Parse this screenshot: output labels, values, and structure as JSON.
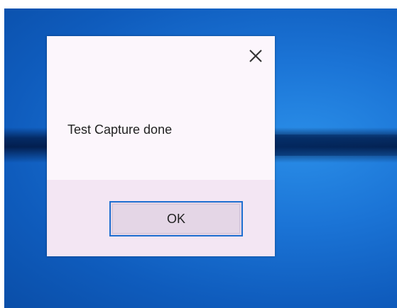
{
  "dialog": {
    "message": "Test Capture done",
    "ok_label": "OK"
  },
  "icons": {
    "close": "close-icon"
  },
  "colors": {
    "desktop_blue": "#1b74d6",
    "dialog_background": "#fcf6fc",
    "footer_background": "#f3e6f3",
    "button_border": "#1f6fd1"
  }
}
